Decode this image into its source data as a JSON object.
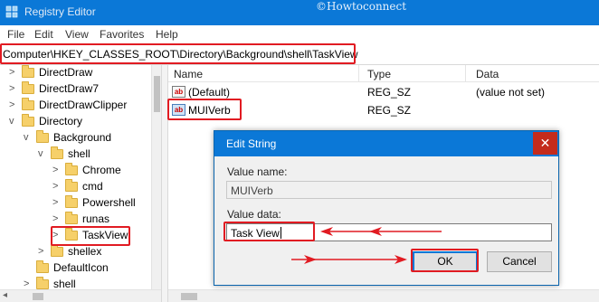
{
  "window": {
    "title": "Registry Editor",
    "watermark": "©Howtoconnect"
  },
  "menu": [
    "File",
    "Edit",
    "View",
    "Favorites",
    "Help"
  ],
  "address": "Computer\\HKEY_CLASSES_ROOT\\Directory\\Background\\shell\\TaskView",
  "tree": [
    {
      "label": "DirectDraw",
      "chevron": ">"
    },
    {
      "label": "DirectDraw7",
      "chevron": ">"
    },
    {
      "label": "DirectDrawClipper",
      "chevron": ">"
    },
    {
      "label": "Directory",
      "chevron": "v"
    },
    {
      "label": "Background",
      "chevron": "v"
    },
    {
      "label": "shell",
      "chevron": "v"
    },
    {
      "label": "Chrome",
      "chevron": ">"
    },
    {
      "label": "cmd",
      "chevron": ">"
    },
    {
      "label": "Powershell",
      "chevron": ">"
    },
    {
      "label": "runas",
      "chevron": ">"
    },
    {
      "label": "TaskView",
      "chevron": ">"
    },
    {
      "label": "shellex",
      "chevron": ">"
    },
    {
      "label": "DefaultIcon",
      "chevron": ""
    },
    {
      "label": "shell",
      "chevron": ">"
    }
  ],
  "list": {
    "columns": [
      "Name",
      "Type",
      "Data"
    ],
    "rows": [
      {
        "icon": "ab",
        "name": "(Default)",
        "type": "REG_SZ",
        "data": "(value not set)"
      },
      {
        "icon": "ab",
        "name": "MUIVerb",
        "type": "REG_SZ",
        "data": ""
      }
    ]
  },
  "dialog": {
    "title": "Edit String",
    "close": "✕",
    "value_name_label": "Value name:",
    "value_name": "MUIVerb",
    "value_data_label": "Value data:",
    "value_data": "Task View",
    "ok": "OK",
    "cancel": "Cancel"
  },
  "colors": {
    "titlebar": "#0b78d7",
    "highlight": "#e11b22",
    "folder": "#f6d06a",
    "close": "#c42b1c"
  }
}
